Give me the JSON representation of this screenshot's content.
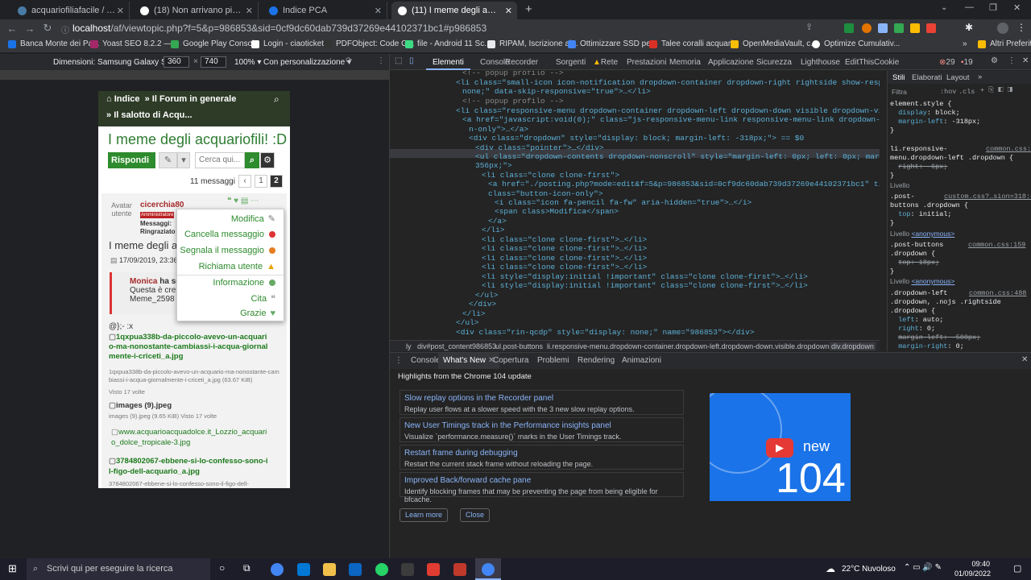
{
  "tabs": [
    {
      "label": "acquariofiliafacile / AF Forum / c",
      "color": "#4a7ba6",
      "active": false
    },
    {
      "label": "(18) Non arrivano più email di no",
      "color": "#fff",
      "active": false
    },
    {
      "label": "Indice PCA",
      "color": "#1a73e8",
      "active": false
    },
    {
      "label": "(11) I meme degli acquariofili! :D",
      "color": "#fff",
      "active": true
    }
  ],
  "address": {
    "host": "localhost",
    "path": "/af/viewtopic.php?f=5&p=986853&sid=0cf9dc60dab739d37269e44102371bc1#p986853"
  },
  "bookmarks": [
    "Banca Monte dei Pa...",
    "Yoast SEO 8.2.2 —...",
    "Google Play Console",
    "Login - ciaotickets",
    "PDFObject: Code G...",
    "file - Android 11 Sc...",
    "RIPAM, Iscrizione ai...",
    "Ottimizzare SSD pe...",
    "Talee coralli acquari...",
    "OpenMediaVault, c...",
    "Optimize Cumulativ..."
  ],
  "bookmarks_other": "Altri Preferiti",
  "device": {
    "label": "Dimensioni: Samsung Galaxy S8+",
    "width": "360",
    "height": "740",
    "zoom": "100%",
    "throttle": "Con personalizzazione"
  },
  "forum": {
    "crumb1": "Indice",
    "crumb2": "Il Forum in generale",
    "crumb3": "Il salotto di Acqu...",
    "title": "I meme degli acquariofili! :D",
    "reply": "Rispondi",
    "search_ph": "Cerca qui...",
    "msg_count": "11 messaggi",
    "page1": "1",
    "page2": "2",
    "avatar_alt": "Avatar utente",
    "author": "cicerchia80",
    "rank": "Amministratore",
    "msg_label": "Messaggi:",
    "thanks_label": "Ringraziato",
    "post_title": "I meme degli ac",
    "post_date": "17/09/2019, 23:36",
    "quote_author": "Monica",
    "quote_verb": "ha sc",
    "quote_line1": "Questa è cre",
    "quote_line2": "Meme_2598",
    "body": "@};- :x",
    "att1": "1qxpua338b-da-piccolo-avevo-un-acquario-ma-nonostante-cambiassi-i-acqua-giornalmente-i-criceti_a.jpg",
    "att1_meta": "1qxpua338b-da-piccolo-avevo-un-acquario-ma-nonostante-cambiassi-i-acqua-giornalmente-i-criceti_a.jpg (63.67 KiB)",
    "att1_views": "Visto 17 volte",
    "att2": "images (9).jpeg",
    "att2_meta": "images (9).jpeg (9.65 KiB) Visto 17 volte",
    "att3": "www.acquarioacquadolce.it_Lozzio_acquario_dolce_tropicale-3.jpg",
    "att4": "3784802067-ebbene-si-lo-confesso-sono-il-figo-dell-acquario_a.jpg",
    "att4_meta": "3784802067-ebbene-si-lo-confesso-sono-il-figo-dell-"
  },
  "dropdown": [
    {
      "label": "Modifica",
      "color": "#777"
    },
    {
      "label": "Cancella messaggio",
      "color": "#d33"
    },
    {
      "label": "Segnala il messaggio",
      "color": "#e67e22"
    },
    {
      "label": "Richiama utente",
      "color": "#e6a100"
    },
    {
      "label": "Informazione",
      "color": "#6a6"
    },
    {
      "label": "Cita",
      "color": "#999"
    },
    {
      "label": "Grazie",
      "color": "#6a6"
    }
  ],
  "devtools": {
    "tabs": [
      "Elementi",
      "Console",
      "Recorder",
      "Sorgenti",
      "Rete",
      "Prestazioni",
      "Memoria",
      "Applicazione",
      "Sicurezza",
      "Lighthouse",
      "EditThisCookie"
    ],
    "errors": "29",
    "warnings": "19",
    "code": [
      "<!-- popup profilo -->",
      "<li class=\"small-icon icon-notification dropdown-container dropdown-right rightside show-responsive\" style=\"display:",
      "none;\" data-skip-responsive=\"true\">…</li>",
      "<!-- popup profilo -->",
      "<li class=\"responsive-menu dropdown-container dropdown-left dropdown-down visible dropdown-visible\">",
      "<a href=\"javascript:void(0);\" class=\"js-responsive-menu-link responsive-menu-link dropdown-toggle button button-ico",
      "n-only\">…</a>",
      "<div class=\"dropdown\" style=\"display: block; margin-left: -318px;\"> == $0",
      "<div class=\"pointer\">…</div>",
      "<ul class=\"dropdown-contents dropdown-nonscroll\" style=\"margin-left: 0px; left: 0px; margin-right: 0px; max-width:",
      "356px;\">",
      "<li class=\"clone clone-first\">",
      "<a href=\"./posting.php?mode=edit&f=5&p=986853&sid=0cf9dc60dab739d37269e44102371bc1\" title=\"Modifica messaggio\"",
      "class=\"button-icon-only\">",
      "<i class=\"icon fa-pencil fa-fw\" aria-hidden=\"true\">…</i>",
      "<span class>Modifica</span>",
      "</a>",
      "</li>",
      "<li class=\"clone clone-first\">…</li>",
      "<li class=\"clone clone-first\">…</li>",
      "<li class=\"clone clone-first\">…</li>",
      "<li class=\"clone clone-first\">…</li>",
      "<li style=\"display:initial !important\" class=\"clone clone-first\">…</li>",
      "<li style=\"display:initial !important\" class=\"clone clone-first\">…</li>",
      "</ul>",
      "</div>",
      "</li>",
      "</ul>",
      "<div class=\"rin-qcdp\" style=\"display: none;\" name=\"986853\"></div>"
    ],
    "breadcrumbs": [
      "ly",
      "div#post_content986853",
      "ul.post-buttons",
      "li.responsive-menu.dropdown-container.dropdown-left.dropdown-down.visible.dropdown-visible",
      "div.dropdown"
    ],
    "styles_tabs": [
      "Stili",
      "Elaborati",
      "Layout"
    ],
    "filter": "Filtra",
    "hov": ":hov",
    "cls": ".cls",
    "drawer_tabs": [
      "Console",
      "What's New",
      "Copertura",
      "Problemi",
      "Rendering",
      "Animazioni"
    ],
    "highlights": "Highlights from the Chrome 104 update",
    "cards": [
      {
        "title": "Slow replay options in the Recorder panel",
        "desc": "Replay user flows at a slower speed with the 3 new slow replay options."
      },
      {
        "title": "New User Timings track in the Performance insights panel",
        "desc": "Visualize `performance.measure()` marks in the User Timings track."
      },
      {
        "title": "Restart frame during debugging",
        "desc": "Restart the current stack frame without reloading the page."
      },
      {
        "title": "Improved Back/forward cache pane",
        "desc": "Identify blocking frames that may be preventing the page from being eligible for bfcache."
      }
    ],
    "learn_more": "Learn more",
    "close": "Close",
    "promo_new": "new",
    "promo_num": "104"
  },
  "taskbar": {
    "search": "Scrivi qui per eseguire la ricerca",
    "weather": "22°C Nuvoloso",
    "time": "09:40",
    "date": "01/09/2022"
  }
}
